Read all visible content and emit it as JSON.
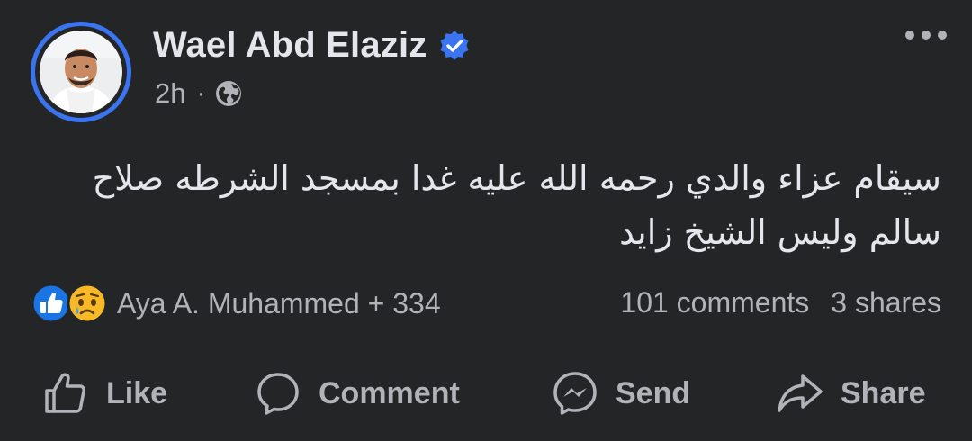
{
  "post": {
    "author": "Wael Abd Elaziz",
    "time": "2h",
    "separator": "·",
    "text": "سيقام عزاء والدي رحمه الله عليه غدا بمسجد الشرطه صلاح سالم وليس الشيخ زايد"
  },
  "reactions": {
    "summary": "Aya A. Muhammed + 334",
    "icons": [
      "like-icon",
      "sad-emoji-icon"
    ],
    "comments": "101 comments",
    "shares": "3 shares"
  },
  "actions": {
    "like": "Like",
    "comment": "Comment",
    "send": "Send",
    "share": "Share"
  },
  "colors": {
    "background": "#242526",
    "text_primary": "#e4e6eb",
    "text_secondary": "#b0b3b8",
    "accent_blue": "#3a74f0"
  }
}
